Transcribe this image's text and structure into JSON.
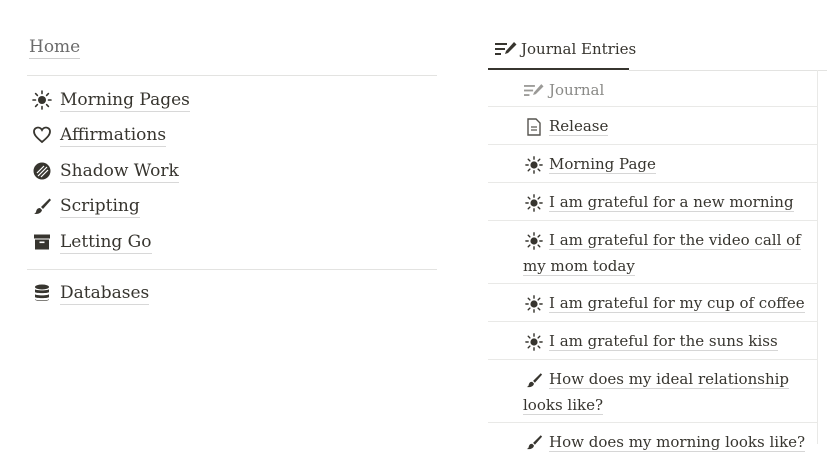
{
  "home": {
    "label": "Home"
  },
  "nav": {
    "items": [
      {
        "label": "Morning Pages",
        "icon": "sun-icon"
      },
      {
        "label": "Affirmations",
        "icon": "heart-icon"
      },
      {
        "label": "Shadow Work",
        "icon": "moon-shadow-icon"
      },
      {
        "label": "Scripting",
        "icon": "brush-icon"
      },
      {
        "label": "Letting Go",
        "icon": "archive-icon"
      }
    ],
    "databases": {
      "label": "Databases",
      "icon": "database-icon"
    }
  },
  "journal": {
    "tab_label": "Journal Entries",
    "tab_icon": "edit-list-icon",
    "header_label": "Journal",
    "rows": [
      {
        "title": "Release",
        "icon": "document-icon"
      },
      {
        "title": "Morning Page",
        "icon": "sun-icon"
      },
      {
        "title": "I am grateful for a new morning",
        "icon": "sun-icon"
      },
      {
        "title": "I am grateful for the video call of my mom today",
        "icon": "sun-icon"
      },
      {
        "title": "I am grateful for my cup of coffee",
        "icon": "sun-icon"
      },
      {
        "title": "I am grateful for the suns kiss",
        "icon": "sun-icon"
      },
      {
        "title": "How does my ideal relationship looks like?",
        "icon": "brush-icon"
      },
      {
        "title": "How does my morning looks like?",
        "icon": "brush-icon"
      }
    ]
  },
  "colors": {
    "text": "#37352f",
    "muted": "#8a8a87",
    "divider": "#e3e3e1"
  }
}
